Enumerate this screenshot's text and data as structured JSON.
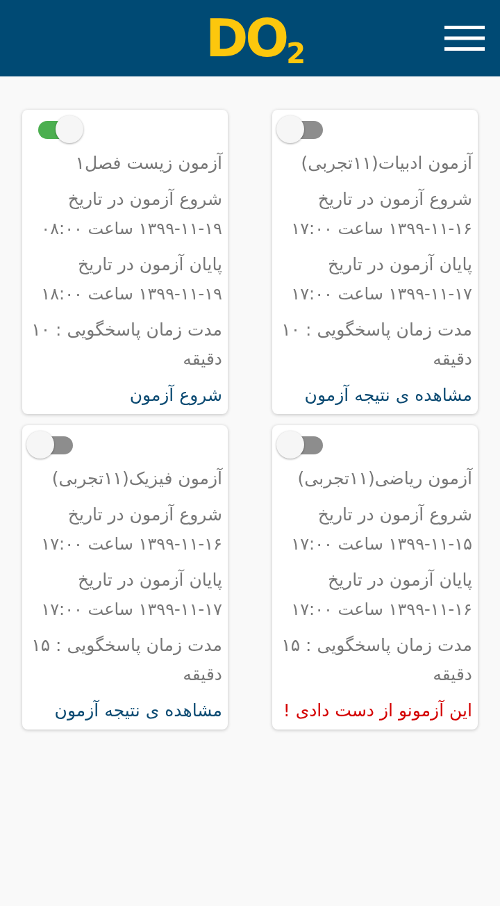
{
  "header": {
    "logo": "DO$_{2}$"
  },
  "exams": [
    {
      "on": false,
      "title": "آزمون ادبیات(۱۱تجربی)",
      "start_label": "شروع آزمون در تاریخ",
      "start_time": "۱۳۹۹-۱۱-۱۶ ساعت ۱۷:۰۰",
      "end_label": "پایان آزمون در تاریخ",
      "end_time": "۱۳۹۹-۱۱-۱۷ ساعت ۱۷:۰۰",
      "duration": "مدت زمان پاسخگویی : ۱۰ دقیقه",
      "action": {
        "kind": "result",
        "label": "مشاهده ی نتیجه آزمون"
      }
    },
    {
      "on": true,
      "title": "آزمون زیست فصل۱",
      "start_label": "شروع آزمون در تاریخ",
      "start_time": "۱۳۹۹-۱۱-۱۹ ساعت ۰۸:۰۰",
      "end_label": "پایان آزمون در تاریخ",
      "end_time": "۱۳۹۹-۱۱-۱۹ ساعت ۱۸:۰۰",
      "duration": "مدت زمان پاسخگویی : ۱۰ دقیقه",
      "action": {
        "kind": "start",
        "label": "شروع آزمون"
      }
    },
    {
      "on": false,
      "title": "آزمون ریاضی(۱۱تجربی)",
      "start_label": "شروع آزمون در تاریخ",
      "start_time": "۱۳۹۹-۱۱-۱۵ ساعت ۱۷:۰۰",
      "end_label": "پایان آزمون در تاریخ",
      "end_time": "۱۳۹۹-۱۱-۱۶ ساعت ۱۷:۰۰",
      "duration": "مدت زمان پاسخگویی : ۱۵ دقیقه",
      "action": {
        "kind": "missed",
        "label": "این آزمونو از دست دادی !"
      }
    },
    {
      "on": false,
      "title": "آزمون فیزیک(۱۱تجربی)",
      "start_label": "شروع آزمون در تاریخ",
      "start_time": "۱۳۹۹-۱۱-۱۶ ساعت ۱۷:۰۰",
      "end_label": "پایان آزمون در تاریخ",
      "end_time": "۱۳۹۹-۱۱-۱۷ ساعت ۱۷:۰۰",
      "duration": "مدت زمان پاسخگویی : ۱۵ دقیقه",
      "action": {
        "kind": "result",
        "label": "مشاهده ی نتیجه آزمون"
      }
    }
  ]
}
